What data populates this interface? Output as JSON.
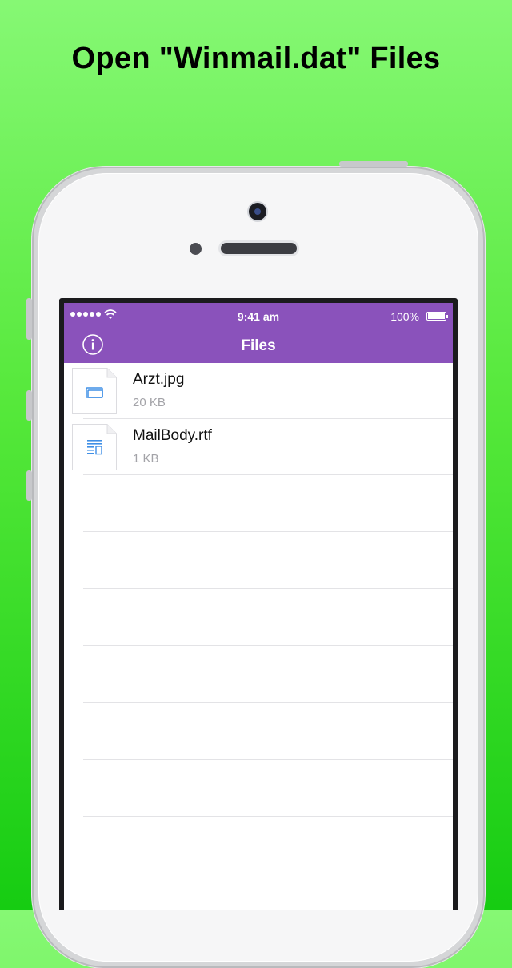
{
  "headline": "Open \"Winmail.dat\" Files",
  "status_bar": {
    "time": "9:41 am",
    "battery": "100%"
  },
  "nav": {
    "title": "Files",
    "info_icon": "info-icon"
  },
  "files": [
    {
      "name": "Arzt.jpg",
      "size": "20 KB",
      "icon": "image-file-icon"
    },
    {
      "name": "MailBody.rtf",
      "size": "1 KB",
      "icon": "document-file-icon"
    }
  ],
  "colors": {
    "accent": "#8a52bb",
    "background_top": "#86f874",
    "background_bottom": "#16cc12"
  }
}
